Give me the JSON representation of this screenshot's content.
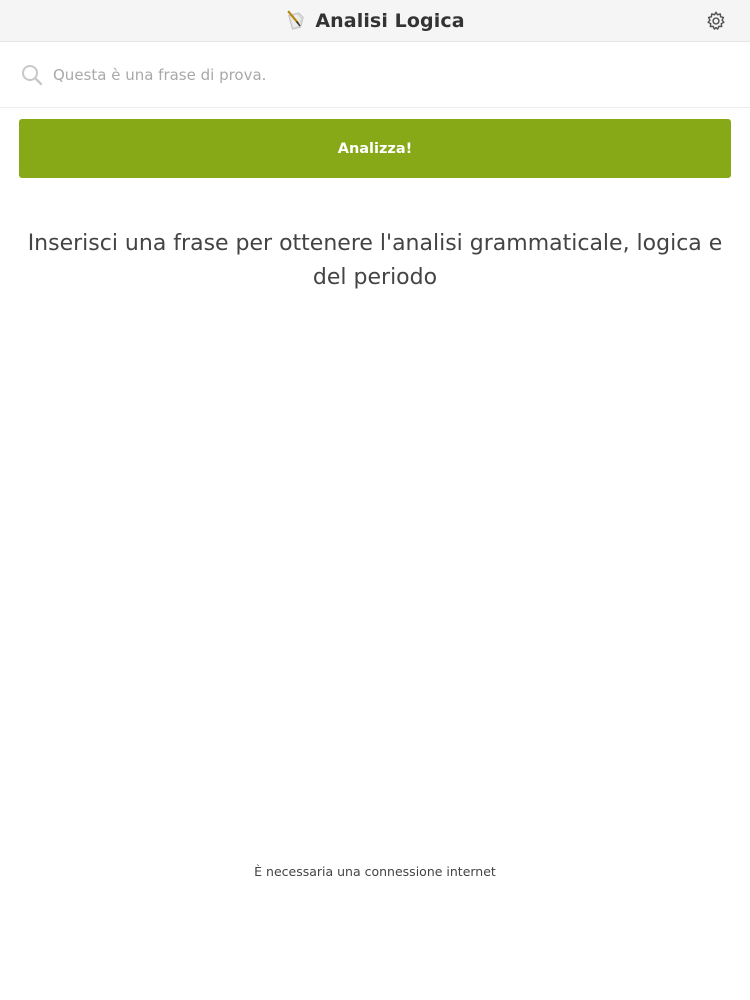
{
  "header": {
    "title": "Analisi Logica",
    "logo_icon": "quill-pen-icon",
    "settings_icon": "gear-icon"
  },
  "search": {
    "icon": "search-icon",
    "placeholder": "Questa è una frase di prova.",
    "value": ""
  },
  "analyze_button": {
    "label": "Analizza!",
    "color": "#87a918"
  },
  "main": {
    "prompt": "Inserisci una frase per ottenere l'analisi grammaticale, logica e del periodo"
  },
  "footer": {
    "note": "È necessaria una connessione internet"
  }
}
